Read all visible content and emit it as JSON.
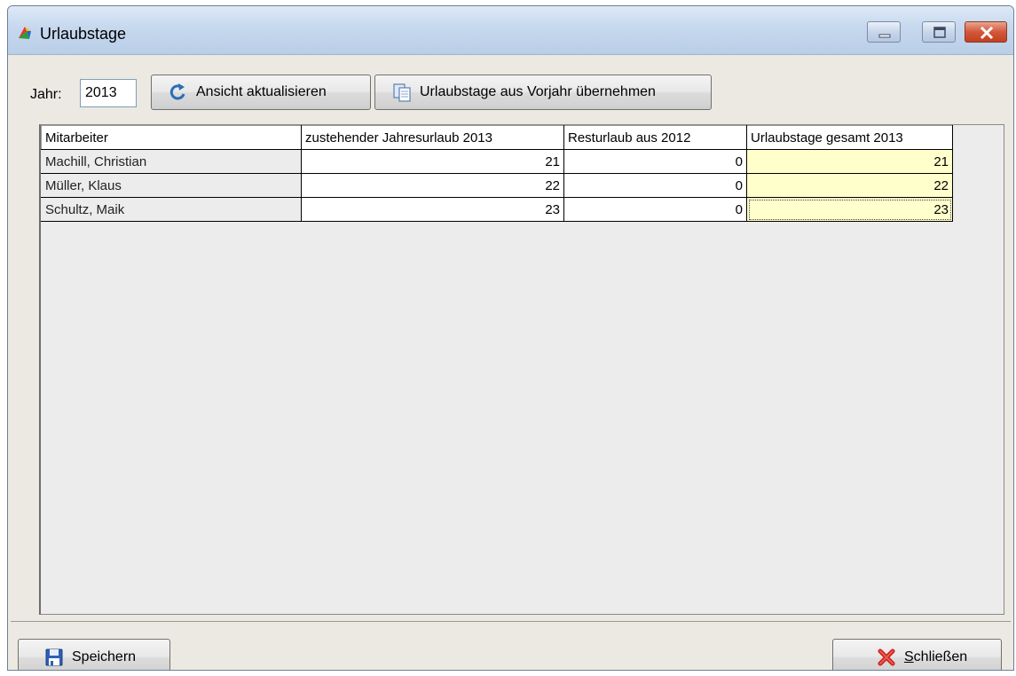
{
  "window": {
    "title": "Urlaubstage",
    "icon": "app-multicolor-icon"
  },
  "toolbar": {
    "jahr_label": "Jahr:",
    "jahr_value": "2013",
    "refresh_label": "Ansicht aktualisieren",
    "refresh_icon": "refresh-icon",
    "copy_label": "Urlaubstage aus Vorjahr übernehmen",
    "copy_icon": "copy-icon"
  },
  "table": {
    "columns": [
      "Mitarbeiter",
      "zustehender Jahresurlaub 2013",
      "Resturlaub aus 2012",
      "Urlaubstage gesamt 2013"
    ],
    "rows": [
      [
        "Machill, Christian",
        "21",
        "0",
        "21"
      ],
      [
        "Müller, Klaus",
        "22",
        "0",
        "22"
      ],
      [
        "Schultz, Maik",
        "23",
        "0",
        "23"
      ]
    ]
  },
  "footer": {
    "save_label": "Speichern",
    "save_icon": "floppy-disk-icon",
    "close_label_first": "S",
    "close_label_rest": "chließen",
    "close_icon": "red-x-icon"
  },
  "colors": {
    "total_cell_bg": "#ffffcc",
    "window_bg": "#ece9e2"
  }
}
